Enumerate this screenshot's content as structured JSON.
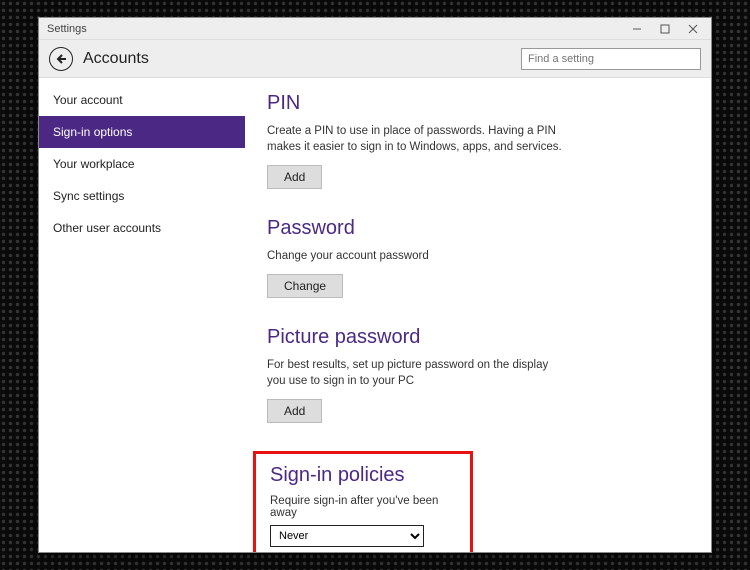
{
  "window": {
    "title": "Settings"
  },
  "header": {
    "title": "Accounts"
  },
  "search": {
    "placeholder": "Find a setting"
  },
  "sidebar": {
    "items": [
      {
        "label": "Your account"
      },
      {
        "label": "Sign-in options"
      },
      {
        "label": "Your workplace"
      },
      {
        "label": "Sync settings"
      },
      {
        "label": "Other user accounts"
      }
    ],
    "selected_index": 1
  },
  "sections": {
    "pin": {
      "title": "PIN",
      "desc": "Create a PIN to use in place of passwords. Having a PIN makes it easier to sign in to Windows, apps, and services.",
      "button": "Add"
    },
    "password": {
      "title": "Password",
      "desc": "Change your account password",
      "button": "Change"
    },
    "picture": {
      "title": "Picture password",
      "desc": "For best results, set up picture password on the display you use to sign in to your PC",
      "button": "Add"
    },
    "signin_policies": {
      "title": "Sign-in policies",
      "label": "Require sign-in after you've been away",
      "value": "Never"
    }
  }
}
